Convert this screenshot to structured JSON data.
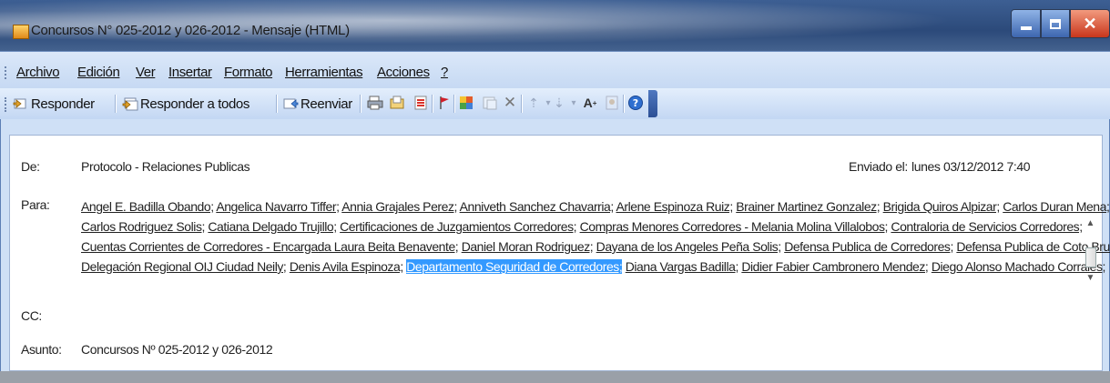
{
  "window": {
    "title": "Concursos N° 025-2012 y 026-2012 - Mensaje (HTML)"
  },
  "menu": [
    {
      "label": "Archivo"
    },
    {
      "label": "Edición"
    },
    {
      "label": "Ver"
    },
    {
      "label": "Insertar"
    },
    {
      "label": "Formato"
    },
    {
      "label": "Herramientas"
    },
    {
      "label": "Acciones"
    },
    {
      "label": "?"
    }
  ],
  "toolbar": {
    "reply_label": "Responder",
    "reply_all_label": "Responder a todos",
    "forward_label": "Reenviar",
    "icons": [
      "print-icon",
      "move-to-folder-icon",
      "rules-icon",
      "flag-icon",
      "categories-icon",
      "mark-unread-icon",
      "delete-icon",
      "previous-item-icon",
      "next-item-icon",
      "font-size-icon",
      "address-book-icon",
      "help-icon"
    ]
  },
  "message": {
    "from_label": "De:",
    "from_value": "Protocolo - Relaciones Publicas",
    "sent_label": "Enviado el:",
    "sent_value": "lunes 03/12/2012 7:40",
    "to_label": "Para:",
    "to_lines": [
      [
        "Angel E. Badilla Obando;",
        "Angelica Navarro Tiffer;",
        "Annia Grajales Perez;",
        "Anniveth Sanchez Chavarria;",
        "Arlene Espinoza Ruiz;",
        "Brainer Martinez Gonzalez;",
        "Brigida Quiros Alpizar;",
        "Carlos Duran Mena;"
      ],
      [
        "Carlos Rodriguez Solis;",
        "Catiana Delgado Trujillo;",
        "Certificaciones de Juzgamientos Corredores;",
        "Compras Menores Corredores - Melania Molina Villalobos;",
        "Contraloria de Servicios Corredores;"
      ],
      [
        "Cuentas Corrientes de Corredores - Encargada Laura Beita Benavente;",
        "Daniel Moran Rodriguez;",
        "Dayana de los Angeles Peña Solis;",
        "Defensa Publica de Corredores;",
        "Defensa Publica de Coto Brus;"
      ],
      [
        "Delegación Regional OIJ Ciudad Neily;",
        "Denis Avila Espinoza;",
        "Departamento Seguridad de Corredores;",
        "Diana Vargas Badilla;",
        "Didier Fabier Cambronero Mendez;",
        "Diego Alonso Machado Corrales;"
      ]
    ],
    "cc_label": "CC:",
    "subject_label": "Asunto:",
    "subject_value": "Concursos Nº 025-2012 y 026-2012"
  },
  "colors": {
    "selection": "#3399ff",
    "title_bar": "#2c4a7a",
    "toolbar_bg": "#c6d9f3"
  }
}
